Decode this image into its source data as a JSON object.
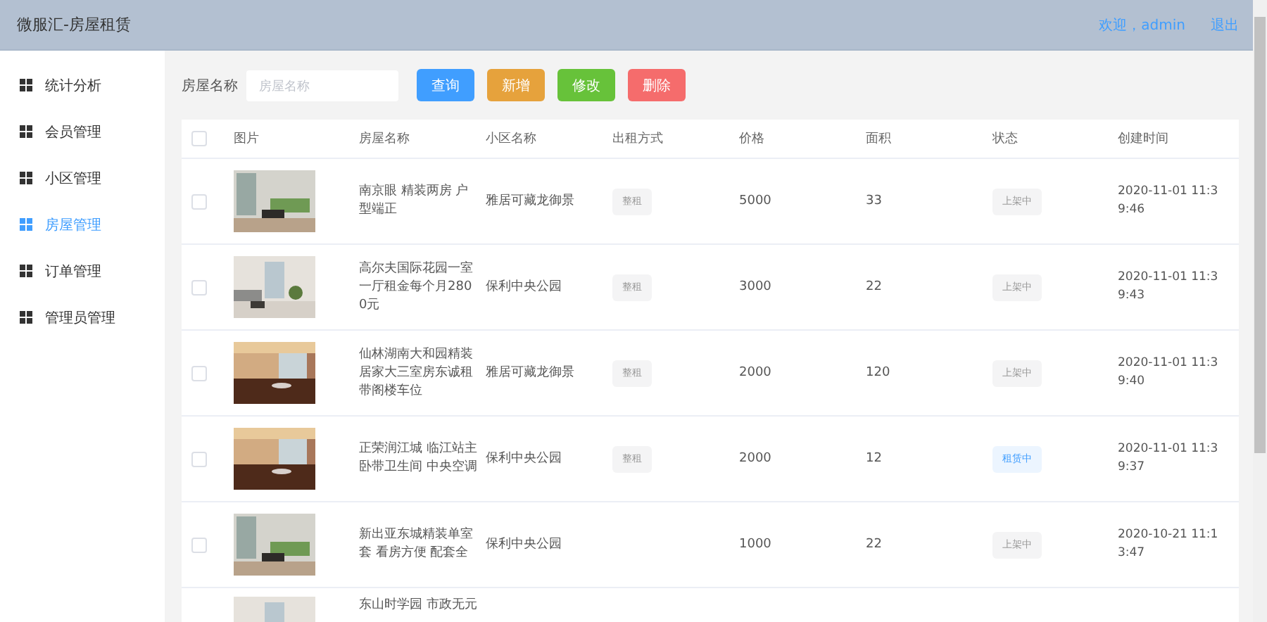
{
  "header": {
    "title": "微服汇-房屋租赁",
    "welcome": "欢迎，admin",
    "logout": "退出"
  },
  "sidebar": {
    "items": [
      {
        "label": "统计分析",
        "selected": false
      },
      {
        "label": "会员管理",
        "selected": false
      },
      {
        "label": "小区管理",
        "selected": false
      },
      {
        "label": "房屋管理",
        "selected": true
      },
      {
        "label": "订单管理",
        "selected": false
      },
      {
        "label": "管理员管理",
        "selected": false
      }
    ]
  },
  "toolbar": {
    "label": "房屋名称",
    "placeholder": "房屋名称",
    "buttons": [
      {
        "label": "查询",
        "kind": "primary"
      },
      {
        "label": "新增",
        "kind": "warning"
      },
      {
        "label": "修改",
        "kind": "success"
      },
      {
        "label": "删除",
        "kind": "danger"
      }
    ]
  },
  "table": {
    "select_all": {
      "checked": false
    },
    "columns": [
      "图片",
      "房屋名称",
      "小区名称",
      "出租方式",
      "价格",
      "面积",
      "状态",
      "创建时间"
    ],
    "rows": [
      {
        "checked": false,
        "name": "南京眼 精装两房 户型端正",
        "community": "雅居可藏龙御景",
        "rent": "整租",
        "price": "5000",
        "area": "33",
        "status": {
          "label": "上架中",
          "kind": "listed"
        },
        "created": "2020-11-01 11:39:46"
      },
      {
        "checked": false,
        "name": "高尔夫国际花园一室一厅租金每个月2800元",
        "community": "保利中央公园",
        "rent": "整租",
        "price": "3000",
        "area": "22",
        "status": {
          "label": "上架中",
          "kind": "listed"
        },
        "created": "2020-11-01 11:39:43"
      },
      {
        "checked": false,
        "name": "仙林湖南大和园精装居家大三室房东诚租带阁楼车位",
        "community": "雅居可藏龙御景",
        "rent": "整租",
        "price": "2000",
        "area": "120",
        "status": {
          "label": "上架中",
          "kind": "listed"
        },
        "created": "2020-11-01 11:39:40"
      },
      {
        "checked": false,
        "name": "正荣润江城 临江站主卧带卫生间 中央空调",
        "community": "保利中央公园",
        "rent": "整租",
        "price": "2000",
        "area": "12",
        "status": {
          "label": "租赁中",
          "kind": "rented"
        },
        "created": "2020-11-01 11:39:37"
      },
      {
        "checked": false,
        "name": "新出亚东城精装单室套 看房方便 配套全",
        "community": "保利中央公园",
        "price": "1000",
        "area": "22",
        "status": {
          "label": "上架中",
          "kind": "listed"
        },
        "created": "2020-10-21 11:13:47"
      },
      {
        "name": "东山时学园 市政无元"
      }
    ]
  }
}
